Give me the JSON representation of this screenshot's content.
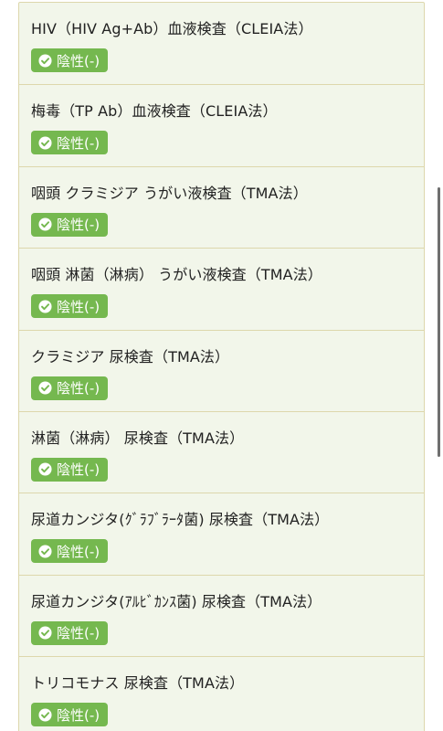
{
  "results": [
    {
      "test_name": "HIV（HIV Ag+Ab）血液検査（CLEIA法）",
      "result": "陰性(-)",
      "icon": "check-circle-icon"
    },
    {
      "test_name": "梅毒（TP Ab）血液検査（CLEIA法）",
      "result": "陰性(-)",
      "icon": "check-circle-icon"
    },
    {
      "test_name": "咽頭 クラミジア うがい液検査（TMA法）",
      "result": "陰性(-)",
      "icon": "check-circle-icon"
    },
    {
      "test_name": "咽頭 淋菌（淋病） うがい液検査（TMA法）",
      "result": "陰性(-)",
      "icon": "check-circle-icon"
    },
    {
      "test_name": "クラミジア 尿検査（TMA法）",
      "result": "陰性(-)",
      "icon": "check-circle-icon"
    },
    {
      "test_name": "淋菌（淋病） 尿検査（TMA法）",
      "result": "陰性(-)",
      "icon": "check-circle-icon"
    },
    {
      "test_name": "尿道カンジタ(ｸﾞﾗﾌﾞﾗｰﾀ菌) 尿検査（TMA法）",
      "result": "陰性(-)",
      "icon": "check-circle-icon"
    },
    {
      "test_name": "尿道カンジタ(ｱﾙﾋﾞｶﾝｽ菌) 尿検査（TMA法）",
      "result": "陰性(-)",
      "icon": "check-circle-icon"
    },
    {
      "test_name": "トリコモナス 尿検査（TMA法）",
      "result": "陰性(-)",
      "icon": "check-circle-icon"
    }
  ],
  "colors": {
    "badge_green": "#75b84f",
    "card_background": "#f2f6ea",
    "card_border": "#ddd7ac"
  }
}
